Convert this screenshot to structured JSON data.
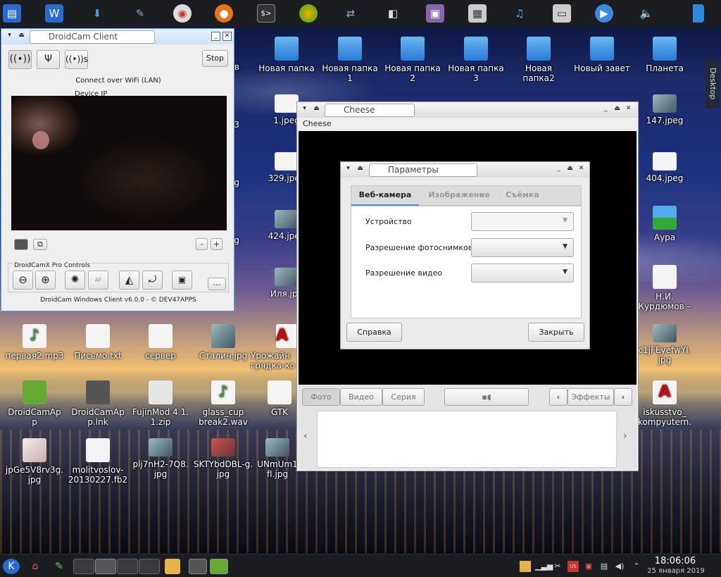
{
  "desktop": {
    "row1": [
      "Новая папка",
      "Новая папка 1",
      "Новая папка 2",
      "Новая папка 3",
      "Новая папка2",
      "Новый завет",
      "Планета"
    ],
    "right_col": [
      "1.jpeg",
      "329.jpeg",
      "424.jpeg",
      "Иля.jpg",
      "147.jpeg",
      "404.jpeg",
      "Аура",
      "Н.И. Курдюмов –"
    ],
    "left_partial": [
      "в",
      "3",
      "g",
      "g"
    ],
    "row_mid": [
      "первая2.mp3",
      "Письмо.txt",
      "сервер",
      "Сталин.jpg",
      "Урожайн грядка-ко",
      "c1jFEyefwYI. jpg"
    ],
    "row_apps": [
      "DroidCamAp p",
      "DroidCamAp p.lnk",
      "FujinMod 4.1. 1.zip",
      "glass_cup break2.wav",
      "GTK",
      "iskusstvo_ kompyutern."
    ],
    "row_bottom": [
      "jpGe5V8rv3g. jpg",
      "molitvoslov- 20130227.fb2",
      "plj7nH2-7Q8. jpg",
      "SKTYbdDBL-g. jpg",
      "UNmUm1 fI.jpg"
    ],
    "side_tab": "Desktop"
  },
  "droidcam": {
    "title": "DroidCam Client",
    "stop": "Stop",
    "connect": "Connect over WiFi (LAN)",
    "device_ip": "Device IP",
    "minus": "-",
    "plus": "+",
    "pro_label": "DroidCamX Pro Controls",
    "af": "AF",
    "more": "...",
    "footer": "DroidCam Windows Client v6.0.0 - © DEV47APPS"
  },
  "cheese": {
    "title": "Cheese",
    "menu": "Cheese",
    "tabs": [
      "Фото",
      "Видео",
      "Серия"
    ],
    "effects": "Эффекты"
  },
  "params": {
    "title": "Параметры",
    "tabs": [
      "Веб-камера",
      "Изображение",
      "Съёмка"
    ],
    "device": "Устройство",
    "photo_res": "Разрешение фотоснимков",
    "video_res": "Разрешение видео",
    "help": "Справка",
    "close": "Закрыть"
  },
  "clock": {
    "time": "18:06:06",
    "date": "25 января 2019"
  }
}
